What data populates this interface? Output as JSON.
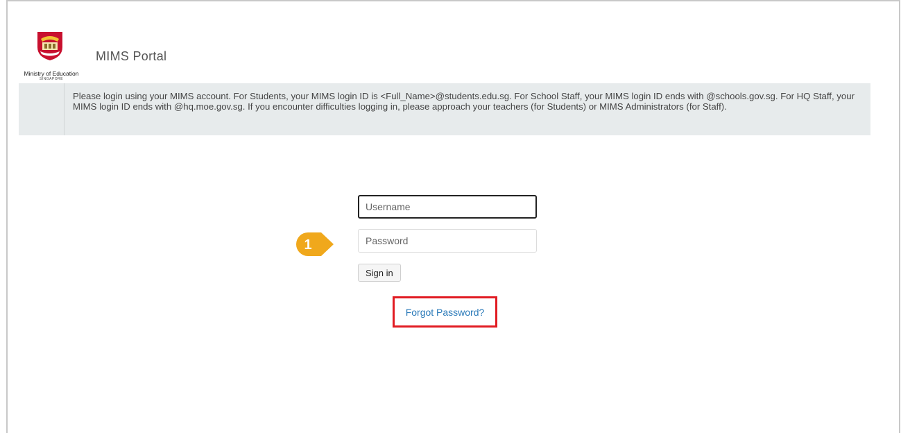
{
  "header": {
    "logo_text": "Ministry of Education",
    "logo_subtext": "SINGAPORE",
    "title": "MIMS Portal"
  },
  "notice": {
    "text": "Please login using your MIMS account. For Students, your MIMS login ID is <Full_Name>@students.edu.sg. For School Staff, your MIMS login ID ends with @schools.gov.sg. For HQ Staff, your MIMS login ID ends with @hq.moe.gov.sg. If you encounter difficulties logging in, please approach your teachers (for Students) or MIMS Administrators (for Staff)."
  },
  "login": {
    "username_placeholder": "Username",
    "password_placeholder": "Password",
    "signin_label": "Sign in",
    "forgot_label": "Forgot Password?"
  },
  "annotation": {
    "step_number": "1",
    "step_color": "#f0a81c",
    "highlight_color": "#e11b22"
  }
}
